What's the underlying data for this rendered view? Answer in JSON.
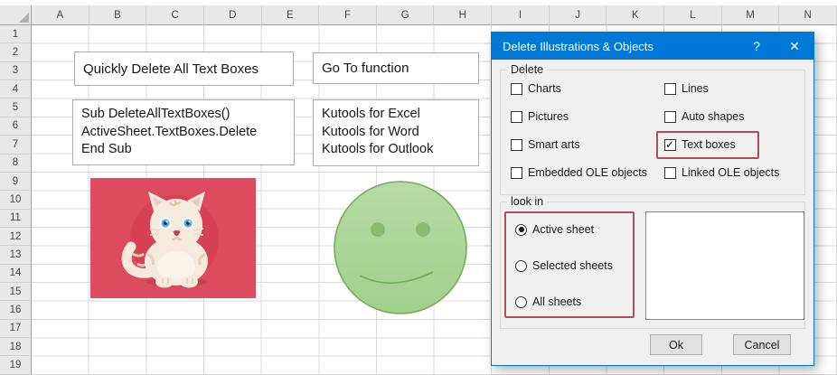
{
  "spreadsheet": {
    "columns": [
      "A",
      "B",
      "C",
      "D",
      "E",
      "F",
      "G",
      "H",
      "I",
      "J",
      "K",
      "L",
      "M",
      "N"
    ],
    "rows": [
      "1",
      "2",
      "3",
      "4",
      "5",
      "6",
      "7",
      "8",
      "9",
      "10",
      "11",
      "12",
      "13",
      "14",
      "15",
      "16",
      "17",
      "18",
      "19"
    ],
    "text_boxes": {
      "title": {
        "text": "Quickly Delete All Text Boxes"
      },
      "vba": {
        "lines": [
          "Sub DeleteAllTextBoxes()",
          "ActiveSheet.TextBoxes.Delete",
          "End Sub"
        ]
      },
      "goto": {
        "text": "Go To function"
      },
      "kutools": {
        "lines": [
          "Kutools for Excel",
          "Kutools for Word",
          "Kutools for Outlook"
        ]
      }
    },
    "images": [
      {
        "name": "cat-illustration",
        "background_color": "#DC4B5E"
      },
      {
        "name": "smiley-face-shape",
        "fill_color": "#ABD496",
        "stroke_color": "#76AB5D"
      }
    ]
  },
  "dialog": {
    "title": "Delete Illustrations & Objects",
    "help_label": "?",
    "close_label": "✕",
    "title_bar_color": "#0078D7",
    "highlight_color": "#B34D5C",
    "delete_group": {
      "label": "Delete",
      "checkboxes": [
        {
          "label": "Charts",
          "checked": false,
          "highlighted": false
        },
        {
          "label": "Lines",
          "checked": false,
          "highlighted": false
        },
        {
          "label": "Pictures",
          "checked": false,
          "highlighted": false
        },
        {
          "label": "Auto shapes",
          "checked": false,
          "highlighted": false
        },
        {
          "label": "Smart arts",
          "checked": false,
          "highlighted": false
        },
        {
          "label": "Text boxes",
          "checked": true,
          "highlighted": true
        },
        {
          "label": "Embedded OLE objects",
          "checked": false,
          "highlighted": false
        },
        {
          "label": "Linked OLE objects",
          "checked": false,
          "highlighted": false
        }
      ],
      "checkmark_glyph": "✓"
    },
    "look_in_group": {
      "label": "look in",
      "radios": [
        {
          "label": "Active sheet",
          "selected": true
        },
        {
          "label": "Selected sheets",
          "selected": false
        },
        {
          "label": "All sheets",
          "selected": false
        }
      ]
    },
    "buttons": {
      "ok": "Ok",
      "cancel": "Cancel"
    }
  }
}
